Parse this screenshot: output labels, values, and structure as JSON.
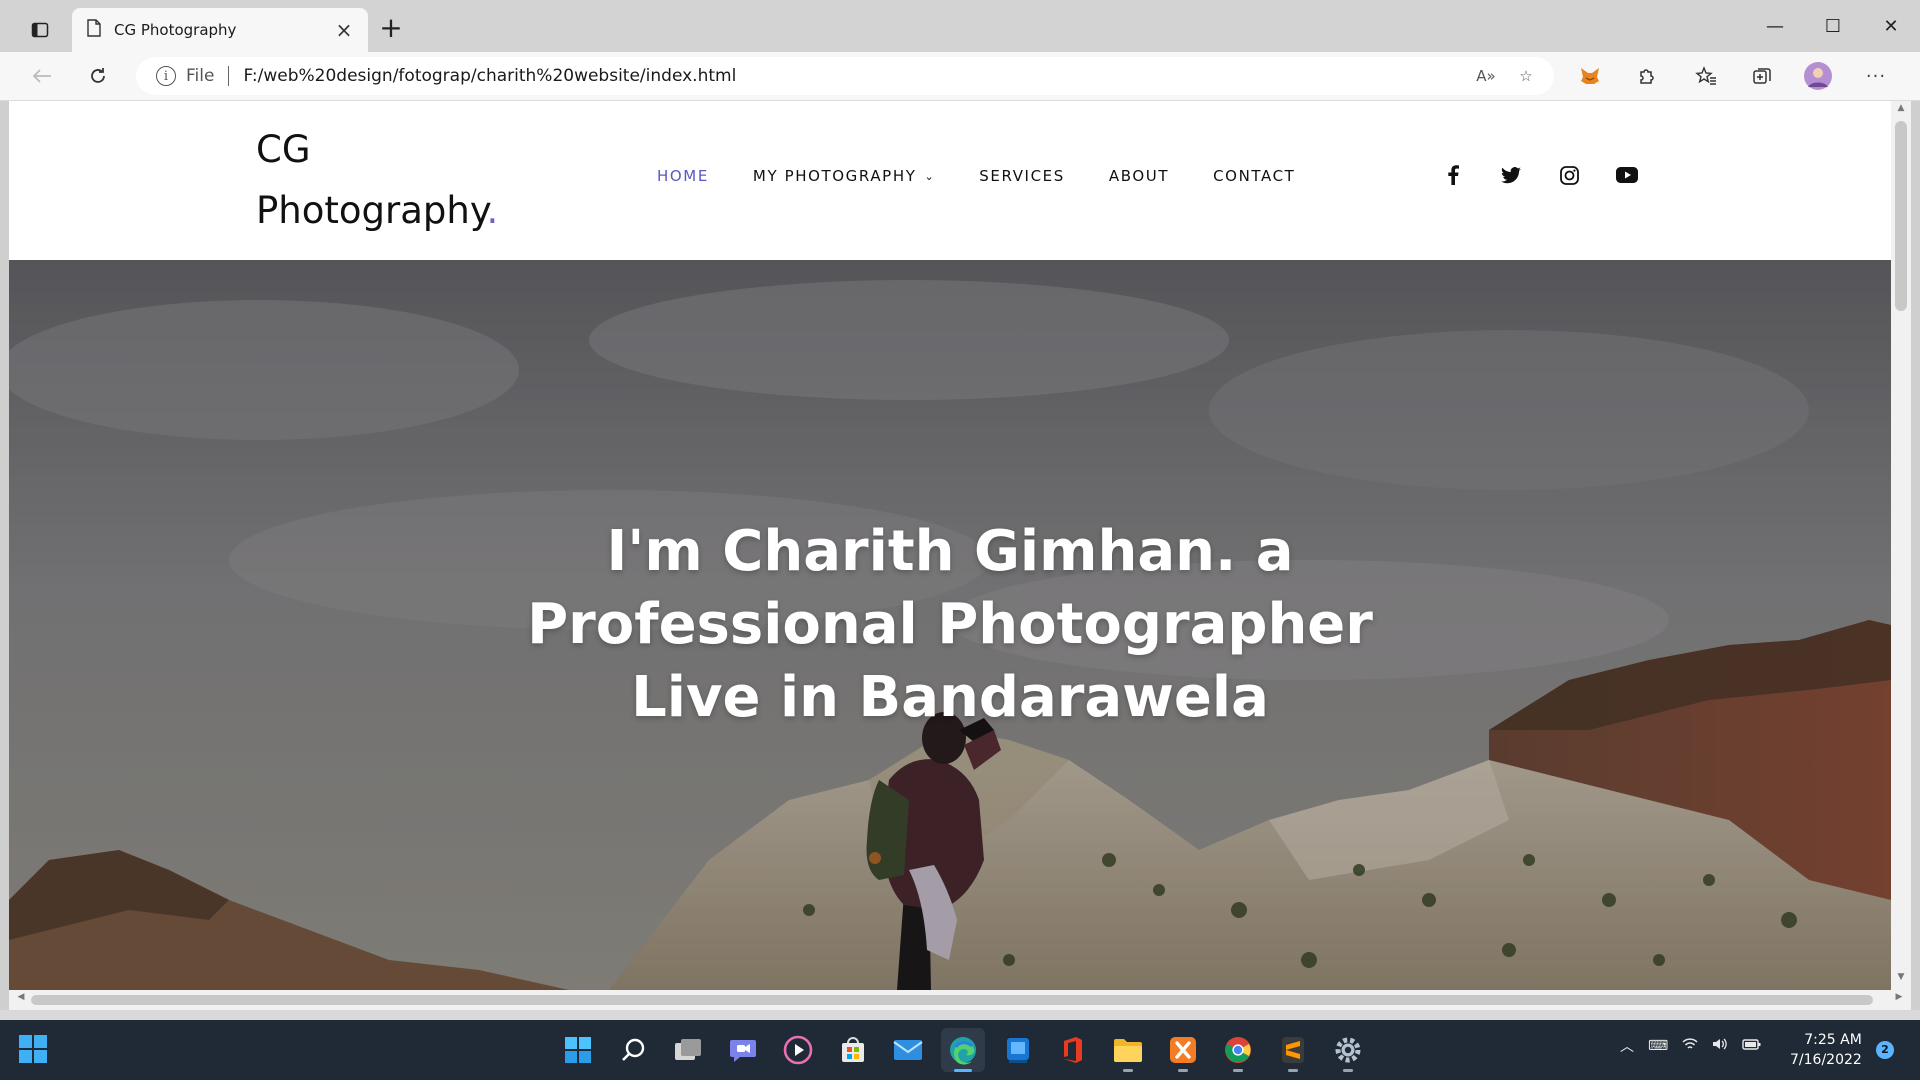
{
  "browser": {
    "tab_title": "CG Photography",
    "url_scheme": "File",
    "url": "F:/web%20design/fotograp/charith%20website/index.html"
  },
  "site": {
    "logo_line1": "CG",
    "logo_line2": "Photography",
    "logo_dot": ".",
    "nav": {
      "home": "HOME",
      "photography": "MY PHOTOGRAPHY",
      "services": "SERVICES",
      "about": "ABOUT",
      "contact": "CONTACT"
    },
    "accent_color": "#5b57c6",
    "hero": {
      "line1": "I'm Charith Gimhan. a",
      "line2": "Professional Photographer",
      "line3": "Live in Bandarawela"
    }
  },
  "taskbar": {
    "time": "7:25 AM",
    "date": "7/16/2022",
    "notifications": "2"
  }
}
